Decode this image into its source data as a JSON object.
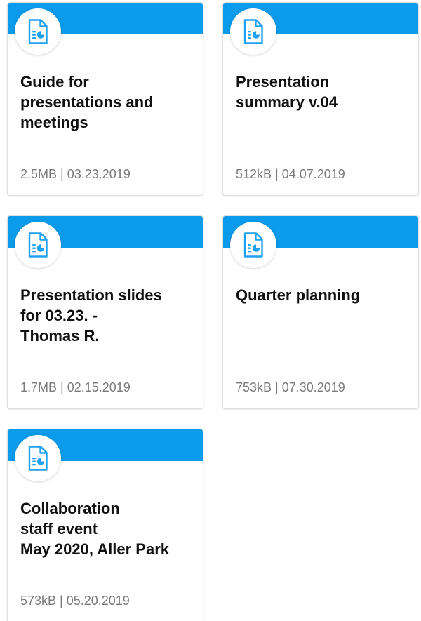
{
  "theme": {
    "accent": "#0c9aea",
    "icon_color": "#1da1f2"
  },
  "files": [
    {
      "icon": "document-chart-icon",
      "title": "Guide for\npresentations and\nmeetings",
      "meta": "2.5MB | 03.23.2019"
    },
    {
      "icon": "document-chart-icon",
      "title": "Presentation\nsummary v.04",
      "meta": "512kB | 04.07.2019"
    },
    {
      "icon": "document-chart-icon",
      "title": "Presentation slides\nfor 03.23. -\nThomas R.",
      "meta": "1.7MB | 02.15.2019"
    },
    {
      "icon": "document-chart-icon",
      "title": "Quarter planning",
      "meta": "753kB | 07.30.2019"
    },
    {
      "icon": "document-chart-icon",
      "title": "Collaboration\nstaff event\nMay 2020, Aller Park",
      "meta": "573kB | 05.20.2019"
    }
  ]
}
